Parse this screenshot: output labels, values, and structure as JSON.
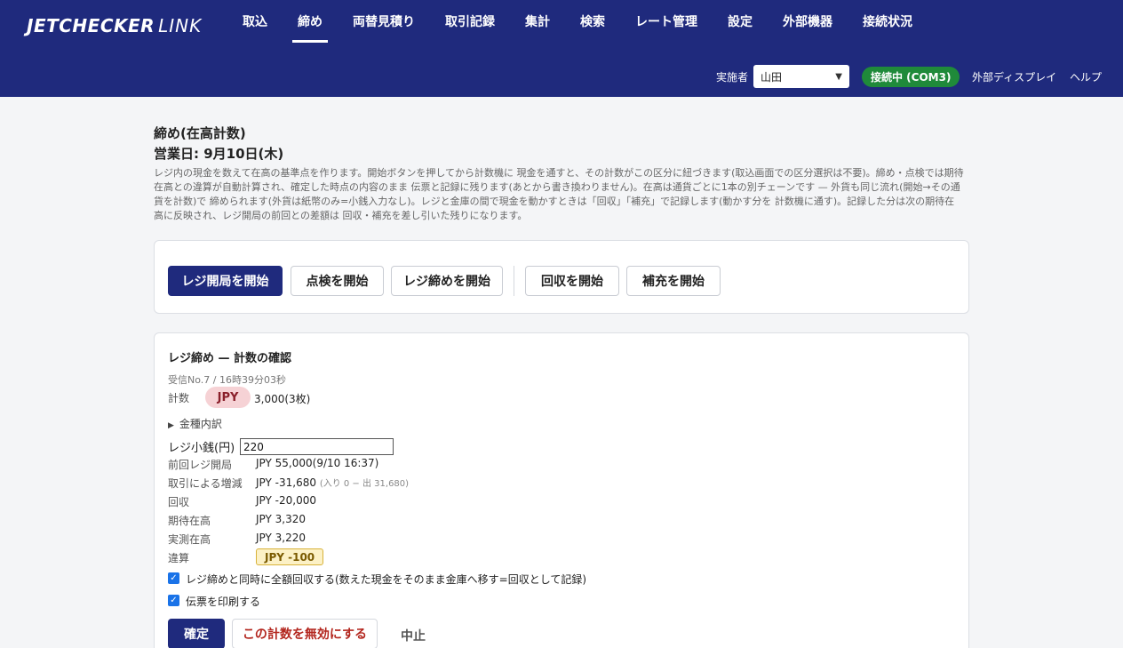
{
  "header": {
    "logo_bold": "JETCHECKER",
    "logo_light": "LINK",
    "nav": [
      "取込",
      "締め",
      "両替見積り",
      "取引記録",
      "集計",
      "検索",
      "レート管理",
      "設定",
      "外部機器",
      "接続状況"
    ],
    "operator_label": "実施者",
    "operator_value": "山田",
    "connection_status": "接続中 (COM3)",
    "external_display": "外部ディスプレイ",
    "help": "ヘルプ"
  },
  "page": {
    "title": "締め(在高計数)",
    "business_day": "営業日: 9月10日(木)",
    "description": "レジ内の現金を数えて在高の基準点を作ります。開始ボタンを押してから計数機に 現金を通すと、その計数がこの区分に紐づきます(取込画面での区分選択は不要)。締め・点検では期待在高との違算が自動計算され、確定した時点の内容のまま 伝票と記録に残ります(あとから書き換わりません)。在高は通貨ごとに1本の別チェーンです — 外貨も同じ流れ(開始→その通貨を計数)で 締められます(外貨は紙幣のみ=小銭入力なし)。レジと金庫の間で現金を動かすときは「回収」「補充」で記録します(動かす分を 計数機に通す)。記録した分は次の期待在高に反映され、レジ開局の前回との差額は 回収・補充を差し引いた残りになります。"
  },
  "actions": {
    "open_register": "レジ開局を開始",
    "inspect": "点検を開始",
    "close_register": "レジ締めを開始",
    "collect": "回収を開始",
    "replenish": "補充を開始"
  },
  "confirm": {
    "title": "レジ締め — 計数の確認",
    "received": "受信No.7 / 16時39分03秒",
    "count_label": "計数",
    "currency": "JPY",
    "count_value": "3,000(3枚)",
    "breakdown_toggle": "金種内訳",
    "float_label": "レジ小銭(円)",
    "float_value": "220",
    "rows": [
      {
        "label": "前回レジ開局",
        "value": "JPY 55,000(9/10 16:37)",
        "sub": ""
      },
      {
        "label": "取引による増減",
        "value": "JPY -31,680",
        "sub": "(入り 0 − 出 31,680)"
      },
      {
        "label": "回収",
        "value": "JPY -20,000",
        "sub": ""
      },
      {
        "label": "期待在高",
        "value": "JPY 3,320",
        "sub": ""
      },
      {
        "label": "実測在高",
        "value": "JPY 3,220",
        "sub": ""
      }
    ],
    "diff_label": "違算",
    "diff_value": "JPY -100",
    "check_collect": "レジ締めと同時に全額回収する(数えた現金をそのまま金庫へ移す=回収として記録)",
    "check_print": "伝票を印刷する",
    "confirm_button": "確定",
    "invalidate_button": "この計数を無効にする",
    "cancel": "中止"
  },
  "colors": {
    "header_bg": "#1f2a7d",
    "primary": "#1f2a7d",
    "connection_green": "#1f8a3a",
    "danger_text": "#b3261e",
    "currency_pill_bg": "#f6d2d5",
    "diff_badge_bg": "#fcf1c6"
  }
}
